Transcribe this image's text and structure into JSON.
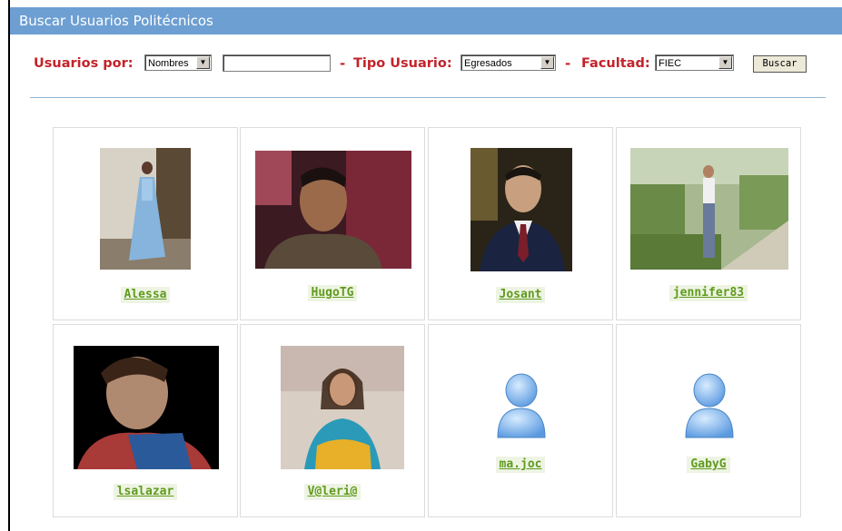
{
  "header": {
    "title": "Buscar Usuarios Politécnicos"
  },
  "search": {
    "usuarios_por_label": "Usuarios por:",
    "usuarios_por_value": "Nombres",
    "text_value": "",
    "separator": "-",
    "tipo_usuario_label": "Tipo Usuario:",
    "tipo_usuario_value": "Egresados",
    "facultad_label": "Facultad:",
    "facultad_value": "FIEC",
    "buscar_label": "Buscar"
  },
  "users": [
    {
      "name": "Alessa",
      "photo": "photo"
    },
    {
      "name": "HugoTG",
      "photo": "photo"
    },
    {
      "name": "Josant",
      "photo": "photo"
    },
    {
      "name": "jennifer83",
      "photo": "photo"
    },
    {
      "name": "lsalazar",
      "photo": "photo"
    },
    {
      "name": "V@leri@",
      "photo": "photo"
    },
    {
      "name": "ma.joc",
      "photo": "default-avatar-icon"
    },
    {
      "name": "GabyG",
      "photo": "default-avatar-icon"
    }
  ],
  "colors": {
    "header_bg": "#6d9fd3",
    "label_red": "#c3232a",
    "link_green": "#5f9b1d"
  }
}
